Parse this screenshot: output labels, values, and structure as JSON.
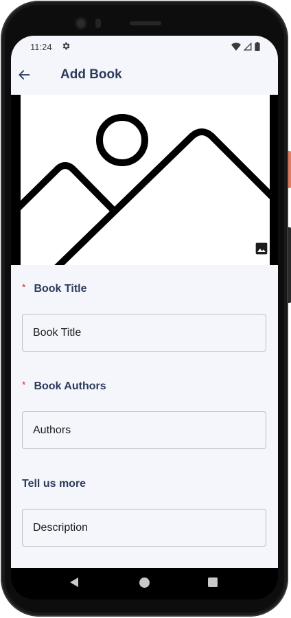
{
  "status_bar": {
    "time": "11:24",
    "icons": [
      "gear-icon",
      "wifi-icon",
      "signal-icon",
      "battery-icon"
    ]
  },
  "app_bar": {
    "title": "Add Book",
    "back_icon": "arrow-back-icon"
  },
  "hero": {
    "placeholder_icon": "image-placeholder-icon",
    "badge_icon": "image-icon"
  },
  "form": {
    "required_marker": "*",
    "title_field": {
      "label": "Book Title",
      "placeholder": "Book Title",
      "value": ""
    },
    "authors_field": {
      "label": "Book Authors",
      "placeholder": "Authors",
      "value": ""
    },
    "description_field": {
      "label": "Tell us more",
      "placeholder": "Description",
      "value": ""
    }
  },
  "nav_bar": {
    "icons": [
      "nav-back-icon",
      "nav-home-icon",
      "nav-recents-icon"
    ]
  },
  "colors": {
    "screen_bg": "#f4f6fc",
    "label_color": "#2c3b5a",
    "required_color": "#d32f2f",
    "device_accent": "#e07b62"
  }
}
